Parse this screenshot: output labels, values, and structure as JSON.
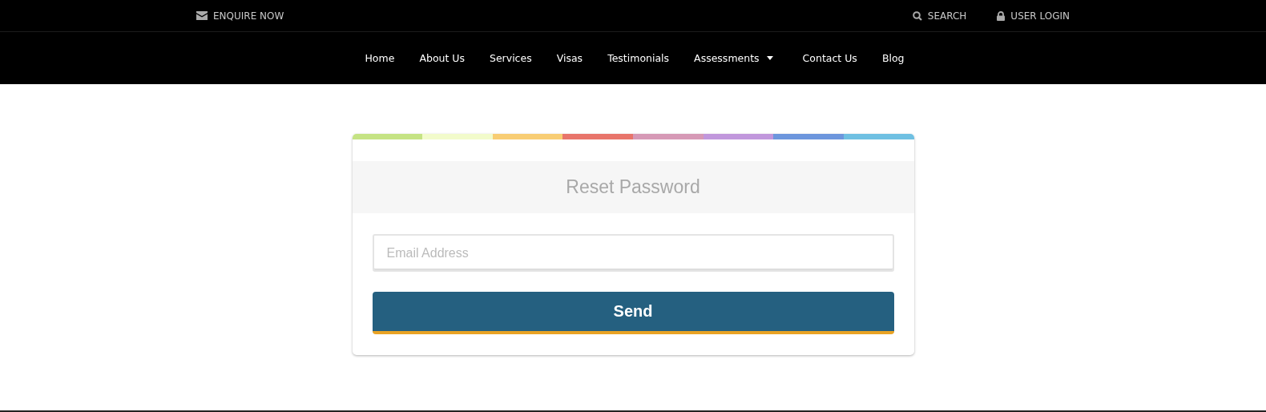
{
  "top_bar": {
    "enquire": "ENQUIRE NOW",
    "search": "SEARCH",
    "login": "USER LOGIN"
  },
  "nav": [
    {
      "label": "Home",
      "dropdown": false
    },
    {
      "label": "About Us",
      "dropdown": false
    },
    {
      "label": "Services",
      "dropdown": false
    },
    {
      "label": "Visas",
      "dropdown": false
    },
    {
      "label": "Testimonials",
      "dropdown": false
    },
    {
      "label": "Assessments",
      "dropdown": true
    },
    {
      "label": "Contact Us",
      "dropdown": false
    },
    {
      "label": "Blog",
      "dropdown": false
    }
  ],
  "card": {
    "stripes": [
      {
        "color": "#c5e384"
      },
      {
        "color": "#f2fbcb"
      },
      {
        "color": "#f8cd74"
      },
      {
        "color": "#e8756b"
      },
      {
        "color": "#d699b6"
      },
      {
        "color": "#c197dc"
      },
      {
        "color": "#6d96dd"
      },
      {
        "color": "#6fc0e2"
      }
    ],
    "title": "Reset Password",
    "email": {
      "placeholder": "Email Address"
    },
    "button": "Send"
  }
}
